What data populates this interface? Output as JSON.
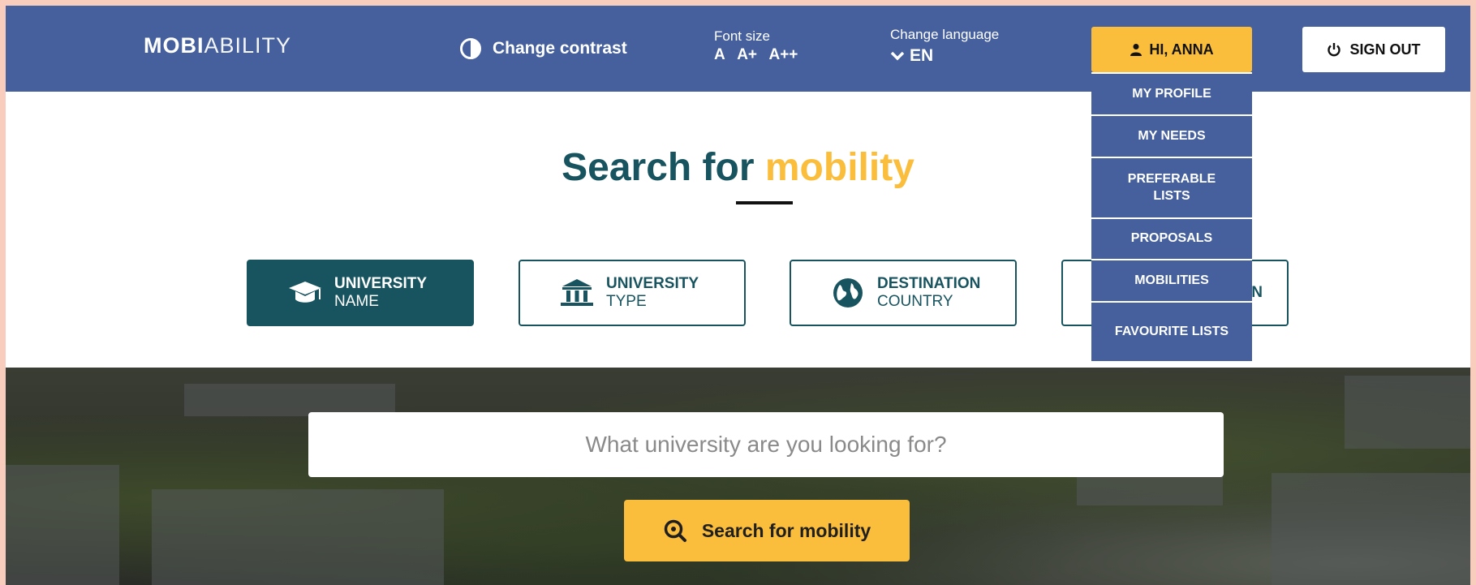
{
  "header": {
    "logo_bold": "MOBI",
    "logo_light": "ABILITY",
    "contrast_label": "Change contrast",
    "font_size_label": "Font size",
    "font_size_options": [
      "A",
      "A+",
      "A++"
    ],
    "language_label": "Change language",
    "language_value": "EN",
    "user_label": "HI, ANNA",
    "signout_label": "SIGN OUT"
  },
  "user_menu": {
    "items": [
      "MY PROFILE",
      "MY NEEDS",
      "PREFERABLE LISTS",
      "PROPOSALS",
      "MOBILITIES",
      "FAVOURITE LISTS"
    ]
  },
  "main": {
    "title_main": "Search for ",
    "title_accent": "mobility",
    "tabs": [
      {
        "line1": "UNIVERSITY",
        "line2": "NAME",
        "icon": "graduation-cap-icon",
        "active": true
      },
      {
        "line1": "UNIVERSITY",
        "line2": "TYPE",
        "icon": "university-building-icon",
        "active": false
      },
      {
        "line1": "DESTINATION",
        "line2": "COUNTRY",
        "icon": "globe-icon",
        "active": false
      },
      {
        "line1": "N",
        "line2": "",
        "icon": "",
        "active": false
      }
    ]
  },
  "search": {
    "placeholder": "What university are you looking for?",
    "button_label": "Search for mobility"
  },
  "colors": {
    "header_bg": "#45609c",
    "accent_yellow": "#fbbd3c",
    "teal": "#17545f"
  }
}
